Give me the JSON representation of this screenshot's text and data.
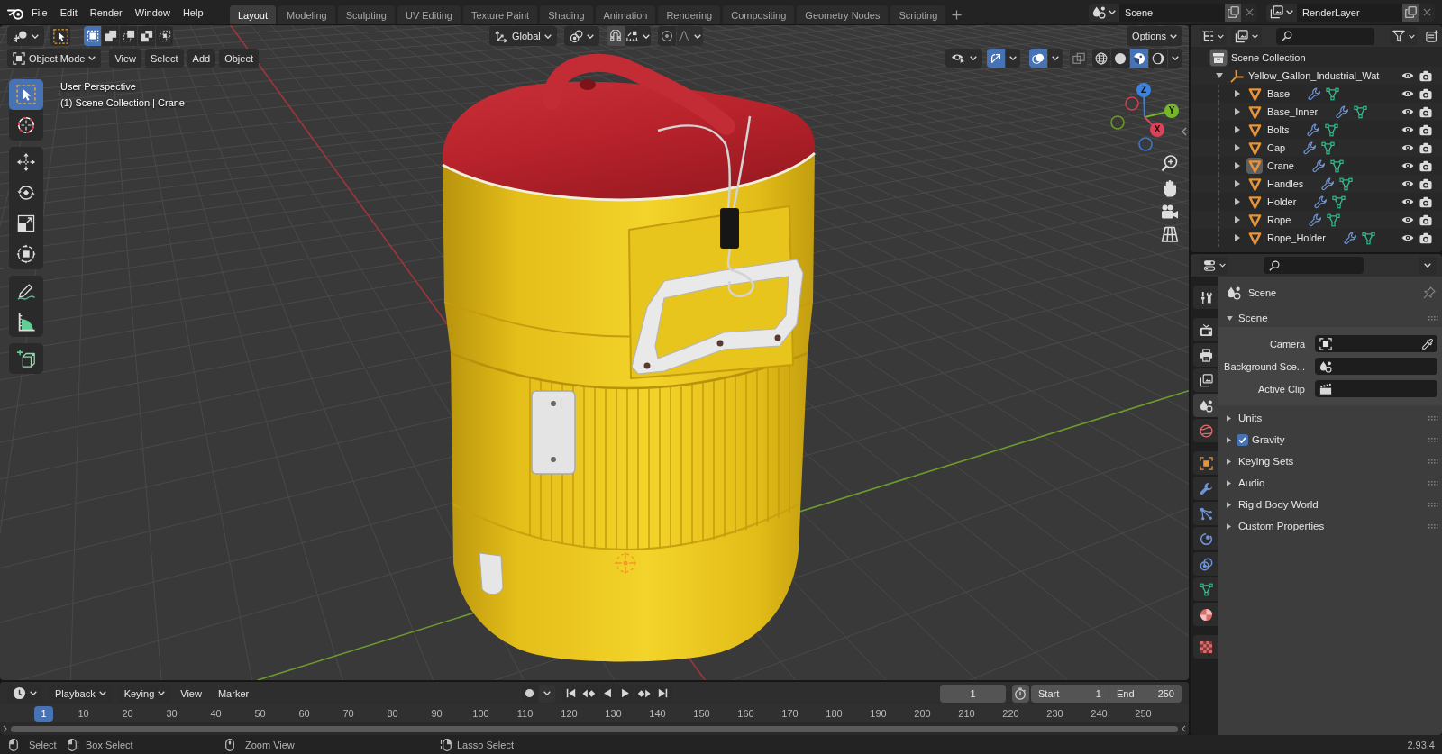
{
  "top_bar": {
    "menus": [
      "File",
      "Edit",
      "Render",
      "Window",
      "Help"
    ],
    "workspaces": [
      {
        "label": "Layout",
        "selected": true
      },
      {
        "label": "Modeling",
        "selected": false
      },
      {
        "label": "Sculpting",
        "selected": false
      },
      {
        "label": "UV Editing",
        "selected": false
      },
      {
        "label": "Texture Paint",
        "selected": false
      },
      {
        "label": "Shading",
        "selected": false
      },
      {
        "label": "Animation",
        "selected": false
      },
      {
        "label": "Rendering",
        "selected": false
      },
      {
        "label": "Compositing",
        "selected": false
      },
      {
        "label": "Geometry Nodes",
        "selected": false
      },
      {
        "label": "Scripting",
        "selected": false
      }
    ],
    "scene": "Scene",
    "view_layer": "RenderLayer"
  },
  "viewport": {
    "header": {
      "select_modes": [
        {
          "kind": "set",
          "selected": true
        },
        {
          "kind": "extend",
          "selected": false
        },
        {
          "kind": "subtract",
          "selected": false
        },
        {
          "kind": "difference",
          "selected": false
        },
        {
          "kind": "intersect",
          "selected": false
        }
      ],
      "orientation": "Global",
      "snapping": {
        "on": false
      },
      "proportional": {
        "on": false
      },
      "options": "Options",
      "mode": "Object Mode",
      "menus": [
        "View",
        "Select",
        "Add",
        "Object"
      ],
      "gizmos": {
        "on": true
      },
      "overlays": {
        "on": true
      },
      "xray": {
        "on": false
      },
      "shading": [
        {
          "kind": "wireframe",
          "selected": false
        },
        {
          "kind": "solid",
          "selected": false
        },
        {
          "kind": "material",
          "selected": true
        },
        {
          "kind": "rendered",
          "selected": false
        }
      ]
    },
    "tool_groups": [
      {
        "tools": [
          {
            "kind": "select_box",
            "selected": true
          },
          {
            "kind": "cursor",
            "selected": false
          }
        ]
      },
      {
        "tools": [
          {
            "kind": "move",
            "selected": false
          },
          {
            "kind": "rotate",
            "selected": false
          },
          {
            "kind": "scale",
            "selected": false
          },
          {
            "kind": "transform",
            "selected": false
          }
        ]
      },
      {
        "tools": [
          {
            "kind": "annotate",
            "selected": false
          },
          {
            "kind": "measure",
            "selected": false
          }
        ]
      },
      {
        "tools": [
          {
            "kind": "add_cube",
            "selected": false
          }
        ]
      }
    ],
    "info": [
      "User Perspective",
      "(1) Scene Collection | Crane"
    ],
    "axis_labels": {
      "x": "X",
      "y": "Y",
      "z": "Z"
    }
  },
  "outliner": {
    "root": "Scene Collection",
    "items": [
      {
        "name": "Yellow_Gallon_Industrial_Wat",
        "kind": "empty",
        "expanded": true,
        "active": false,
        "children": [
          {
            "name": "Base",
            "kind": "mesh",
            "expanded": false,
            "active": false
          },
          {
            "name": "Base_Inner",
            "kind": "mesh",
            "expanded": false,
            "active": false
          },
          {
            "name": "Bolts",
            "kind": "mesh",
            "expanded": false,
            "active": false
          },
          {
            "name": "Cap",
            "kind": "mesh",
            "expanded": false,
            "active": false
          },
          {
            "name": "Crane",
            "kind": "mesh",
            "expanded": false,
            "active": true
          },
          {
            "name": "Handles",
            "kind": "mesh",
            "expanded": false,
            "active": false
          },
          {
            "name": "Holder",
            "kind": "mesh",
            "expanded": false,
            "active": false
          },
          {
            "name": "Rope",
            "kind": "mesh",
            "expanded": false,
            "active": false
          },
          {
            "name": "Rope_Holder",
            "kind": "mesh",
            "expanded": false,
            "active": false
          }
        ]
      }
    ]
  },
  "properties": {
    "tab_groups": [
      {
        "tabs": [
          {
            "kind": "tool",
            "selected": false
          }
        ]
      },
      {
        "tabs": [
          {
            "kind": "render",
            "selected": false
          },
          {
            "kind": "output",
            "selected": false
          },
          {
            "kind": "view_layer",
            "selected": false
          },
          {
            "kind": "scene",
            "selected": true
          },
          {
            "kind": "world",
            "selected": false
          }
        ]
      },
      {
        "tabs": [
          {
            "kind": "object",
            "selected": false
          },
          {
            "kind": "modifiers",
            "selected": false
          },
          {
            "kind": "particles",
            "selected": false
          },
          {
            "kind": "physics",
            "selected": false
          },
          {
            "kind": "constraints",
            "selected": false
          },
          {
            "kind": "data",
            "selected": false
          },
          {
            "kind": "material",
            "selected": false
          }
        ]
      },
      {
        "tabs": [
          {
            "kind": "texture",
            "selected": false
          }
        ]
      }
    ],
    "context": "Scene",
    "panels": [
      {
        "title": "Scene",
        "kind": "plain",
        "expanded": true,
        "fields": [
          {
            "label": "Camera",
            "kind": "object"
          },
          {
            "label": "Background Sce...",
            "kind": "scene"
          },
          {
            "label": "Active Clip",
            "kind": "clip"
          }
        ]
      },
      {
        "title": "Units",
        "kind": "plain",
        "expanded": false
      },
      {
        "title": "Gravity",
        "kind": "toggle",
        "checked": true,
        "expanded": false
      },
      {
        "title": "Keying Sets",
        "kind": "plain",
        "expanded": false
      },
      {
        "title": "Audio",
        "kind": "plain",
        "expanded": false
      },
      {
        "title": "Rigid Body World",
        "kind": "plain",
        "expanded": false
      },
      {
        "title": "Custom Properties",
        "kind": "plain",
        "expanded": false
      }
    ]
  },
  "timeline": {
    "menus": [
      {
        "label": "Playback",
        "kind": "dropdown"
      },
      {
        "label": "Keying",
        "kind": "dropdown"
      },
      {
        "label": "View",
        "kind": "menu"
      },
      {
        "label": "Marker",
        "kind": "menu"
      }
    ],
    "current_frame": "1",
    "start": {
      "label": "Start",
      "value": "1"
    },
    "end": {
      "label": "End",
      "value": "250"
    },
    "playhead": "1",
    "ruler": [
      "10",
      "20",
      "30",
      "40",
      "50",
      "60",
      "70",
      "80",
      "90",
      "100",
      "110",
      "120",
      "130",
      "140",
      "150",
      "160",
      "170",
      "180",
      "190",
      "200",
      "210",
      "220",
      "230",
      "240",
      "250"
    ]
  },
  "status_bar": {
    "hints": [
      {
        "kind": "left_click",
        "label": "Select"
      },
      {
        "kind": "left_drag",
        "label": "Box Select"
      },
      {
        "kind": "middle_click",
        "label": "Zoom View"
      },
      {
        "kind": "right_drag",
        "label": "Lasso Select"
      }
    ],
    "version": "2.93.4"
  }
}
